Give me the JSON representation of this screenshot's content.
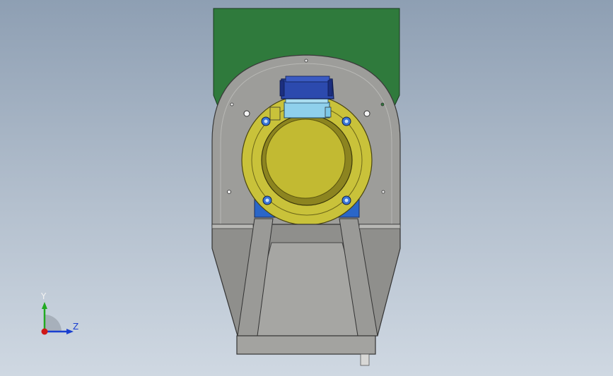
{
  "viewport": {
    "background_top": "#8e9fb3",
    "background_bottom": "#cfd8e2"
  },
  "model": {
    "colors": {
      "housing_green": "#2f7a3c",
      "plate_gray": "#9b9b98",
      "flange_yellow": "#c8c23a",
      "bore_yellow": "#b4ab24",
      "motor_blue": "#2848a8",
      "bracket_cyan": "#7cc8e8",
      "chute_gray": "#8f8f8c"
    }
  },
  "triad": {
    "y_label": "Y",
    "z_label": "Z",
    "y_color": "#22aa22",
    "z_color": "#1a3fd0",
    "x_color": "#d01818"
  }
}
